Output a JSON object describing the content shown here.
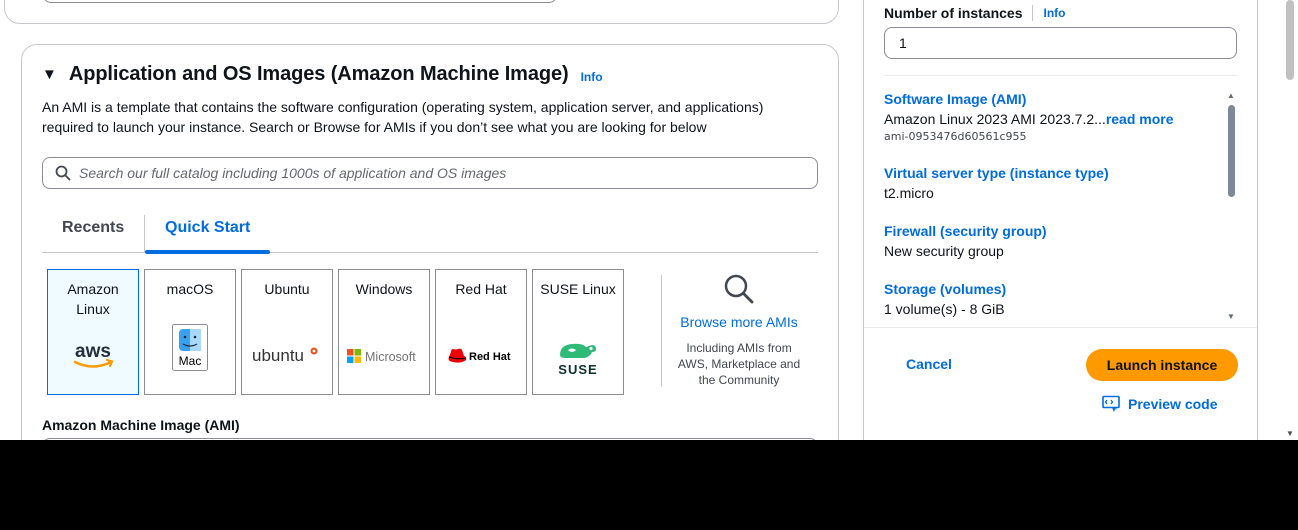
{
  "ami_section": {
    "caret": "▼",
    "title": "Application and OS Images (Amazon Machine Image)",
    "info": "Info",
    "description": "An AMI is a template that contains the software configuration (operating system, application server, and applications) required to launch your instance. Search or Browse for AMIs if you don’t see what you are looking for below",
    "search_placeholder": "Search our full catalog including 1000s of application and OS images",
    "tabs": [
      {
        "label": "Recents",
        "active": false
      },
      {
        "label": "Quick Start",
        "active": true
      }
    ],
    "tiles": [
      {
        "label": "Amazon Linux",
        "logo": "aws-logo",
        "logo_text": "aws",
        "selected": true
      },
      {
        "label": "macOS",
        "logo": "mac-finder-icon",
        "logo_text": "Mac",
        "selected": false
      },
      {
        "label": "Ubuntu",
        "logo": "ubuntu-logo",
        "logo_text": "ubuntu",
        "selected": false
      },
      {
        "label": "Windows",
        "logo": "microsoft-logo",
        "logo_text": "Microsoft",
        "selected": false
      },
      {
        "label": "Red Hat",
        "logo": "redhat-logo",
        "logo_text": "Red Hat",
        "selected": false
      },
      {
        "label": "SUSE Linux",
        "logo": "suse-logo",
        "logo_text": "SUSE",
        "selected": false
      }
    ],
    "browse_link": "Browse more AMIs",
    "browse_sub": "Including AMIs from AWS, Marketplace and the Community",
    "ami_label": "Amazon Machine Image (AMI)"
  },
  "summary": {
    "num_instances_label": "Number of instances",
    "num_instances_info": "Info",
    "num_instances_value": "1",
    "items": [
      {
        "key": "Software Image (AMI)",
        "value": "Amazon Linux 2023 AMI 2023.7.2...",
        "more": "read more",
        "sub": "ami-0953476d60561c955"
      },
      {
        "key": "Virtual server type (instance type)",
        "value": "t2.micro"
      },
      {
        "key": "Firewall (security group)",
        "value": "New security group"
      },
      {
        "key": "Storage (volumes)",
        "value": "1 volume(s) - 8 GiB"
      }
    ],
    "cancel": "Cancel",
    "launch": "Launch instance",
    "preview": "Preview code"
  },
  "colors": {
    "link": "#006ce0",
    "launch_button": "#ff9900",
    "selected_tile_bg": "#f0fbff"
  }
}
